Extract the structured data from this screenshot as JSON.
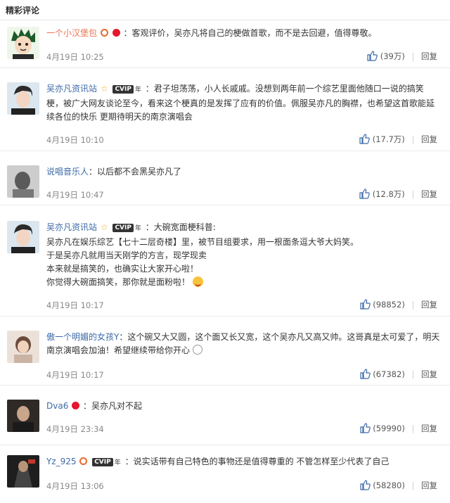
{
  "header": {
    "title": "精彩评论"
  },
  "comments": [
    {
      "name": "一个小汉堡包",
      "content": "：客观评价，吴亦凡将自己的梗做首歌，而不是去回避，值得尊敬。",
      "date": "4月19日",
      "time": "10:25",
      "likes": "(39万)",
      "reply": "回复",
      "avatar_color": "#e8f4e0"
    },
    {
      "name": "吴亦凡资讯站",
      "vip": "CVIP",
      "vip_suffix": "年",
      "content": "：君子坦荡荡，小人长戚戚。没想到两年前一个综艺里面他随口一说的搞笑梗，被广大网友谈论至今，看来这个梗真的是发挥了应有的价值。佩服吴亦凡的胸襟，也希望这首歌能延续各位的快乐 更期待明天的南京演唱会",
      "date": "4月19日",
      "time": "10:10",
      "likes": "(17.7万)",
      "reply": "回复",
      "avatar_color": "#d8e4ee"
    },
    {
      "name": "说唱音乐人",
      "content": "：以后都不会黑吴亦凡了",
      "date": "4月19日",
      "time": "10:47",
      "likes": "(12.8万)",
      "reply": "回复",
      "avatar_color": "#cfcfcf"
    },
    {
      "name": "吴亦凡资讯站",
      "vip": "CVIP",
      "vip_suffix": "年",
      "content": "：大碗宽面梗科普:",
      "lines": [
        "吴亦凡在娱乐综艺【七十二层奇楼】里，被节目组要求，用一根面条逗大爷大妈笑。",
        "于是吴亦凡就用当天刚学的方言，现学现卖",
        "本来就是搞笑的，也确实让大家开心啦！",
        "你觉得大碗面搞笑，那你就是面粉啦！"
      ],
      "date": "4月19日",
      "time": "10:17",
      "likes": "(98852)",
      "reply": "回复",
      "avatar_color": "#d8e4ee"
    },
    {
      "name": "傲一个明媚的女孩Y",
      "content": "：这个碗又大又圆，这个面又长又宽，这个吴亦凡又高又帅。这哥真是太可爱了，明天南京演唱会加油！希望继续带给你开心",
      "date": "4月19日",
      "time": "10:17",
      "likes": "(67382)",
      "reply": "回复",
      "avatar_color": "#e9dcd2"
    },
    {
      "name": "Dva6",
      "content": "：吴亦凡对不起",
      "date": "4月19日",
      "time": "23:34",
      "likes": "(59990)",
      "reply": "回复",
      "avatar_color": "#3a3a3a"
    },
    {
      "name": "Yz_925",
      "vip": "CVIP",
      "vip_suffix": "年",
      "content": "：说实话带有自己特色的事物还是值得尊重的 不管怎样至少代表了自己",
      "date": "4月19日",
      "time": "13:06",
      "likes": "(58280)",
      "reply": "回复",
      "avatar_color": "#2a2a2a"
    }
  ]
}
